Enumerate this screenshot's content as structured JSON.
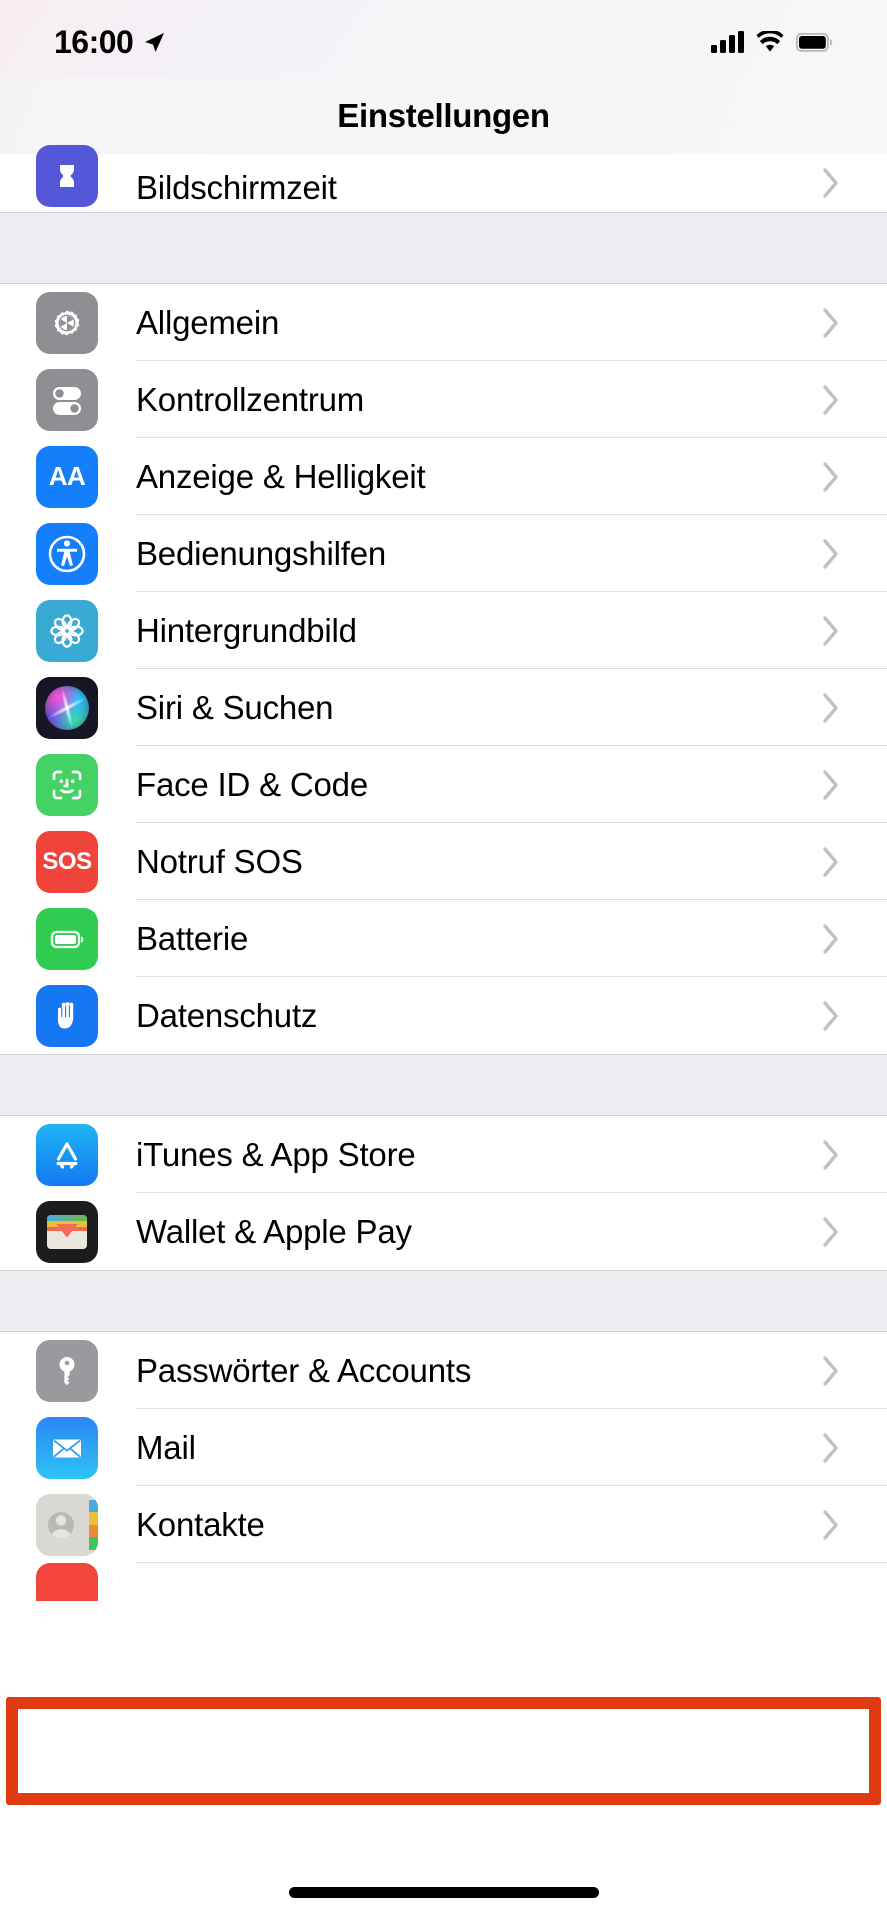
{
  "status_bar": {
    "time": "16:00",
    "location_icon": "location-arrow-icon",
    "cellular_icon": "cellular-bars-icon",
    "wifi_icon": "wifi-icon",
    "battery_icon": "battery-full-icon"
  },
  "header": {
    "title": "Einstellungen"
  },
  "groups": [
    {
      "id": "group-screentime",
      "clipped": "top",
      "items": [
        {
          "label": "Bildschirmzeit",
          "icon": "hourglass-icon",
          "icon_class": "ic-screentime",
          "accessory": "chevron-right-icon"
        }
      ]
    },
    {
      "id": "group-system",
      "items": [
        {
          "label": "Allgemein",
          "icon": "gear-icon",
          "icon_class": "ic-general",
          "accessory": "chevron-right-icon"
        },
        {
          "label": "Kontrollzentrum",
          "icon": "toggles-icon",
          "icon_class": "ic-control",
          "accessory": "chevron-right-icon"
        },
        {
          "label": "Anzeige & Helligkeit",
          "icon": "aa-text-icon",
          "icon_class": "ic-display",
          "accessory": "chevron-right-icon"
        },
        {
          "label": "Bedienungshilfen",
          "icon": "accessibility-icon",
          "icon_class": "ic-access",
          "accessory": "chevron-right-icon"
        },
        {
          "label": "Hintergrundbild",
          "icon": "flower-icon",
          "icon_class": "ic-wallpaper",
          "accessory": "chevron-right-icon"
        },
        {
          "label": "Siri & Suchen",
          "icon": "siri-orb-icon",
          "icon_class": "ic-siri",
          "accessory": "chevron-right-icon"
        },
        {
          "label": "Face ID & Code",
          "icon": "face-id-icon",
          "icon_class": "ic-faceid",
          "accessory": "chevron-right-icon"
        },
        {
          "label": "Notruf SOS",
          "icon": "sos-icon",
          "icon_class": "ic-sos",
          "accessory": "chevron-right-icon"
        },
        {
          "label": "Batterie",
          "icon": "battery-icon",
          "icon_class": "ic-battery",
          "accessory": "chevron-right-icon"
        },
        {
          "label": "Datenschutz",
          "icon": "hand-icon",
          "icon_class": "ic-privacy",
          "accessory": "chevron-right-icon"
        }
      ]
    },
    {
      "id": "group-store",
      "items": [
        {
          "label": "iTunes & App Store",
          "icon": "app-store-icon",
          "icon_class": "ic-appstore",
          "accessory": "chevron-right-icon"
        },
        {
          "label": "Wallet & Apple Pay",
          "icon": "wallet-icon",
          "icon_class": "ic-wallet",
          "accessory": "chevron-right-icon"
        }
      ]
    },
    {
      "id": "group-accounts",
      "items": [
        {
          "label": "Passwörter & Accounts",
          "icon": "key-icon",
          "icon_class": "ic-passwords",
          "accessory": "chevron-right-icon"
        },
        {
          "label": "Mail",
          "icon": "envelope-icon",
          "icon_class": "ic-mail",
          "accessory": "chevron-right-icon",
          "highlighted": true
        },
        {
          "label": "Kontakte",
          "icon": "contacts-icon",
          "icon_class": "ic-contacts",
          "accessory": "chevron-right-icon"
        }
      ]
    }
  ],
  "annotation": {
    "target_label": "Mail",
    "color": "#e03a10",
    "shape": "rectangle-outline"
  },
  "sos_label": "SOS",
  "aa_label": "AA",
  "home_indicator": "home-indicator-bar"
}
